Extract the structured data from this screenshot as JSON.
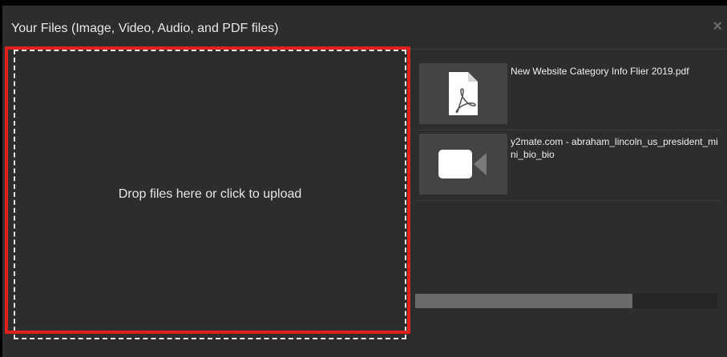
{
  "modal": {
    "title": "Your Files (Image, Video, Audio, and PDF files)",
    "close_label": "×"
  },
  "dropzone": {
    "label": "Drop files here or click to upload",
    "highlight_color": "#e0201f"
  },
  "files": [
    {
      "name": "New Website Category Info Flier 2019.pdf",
      "icon": "pdf-file-icon"
    },
    {
      "name": "y2mate.com - abraham_lincoln_us_president_mini_bio_bio",
      "icon": "video-camera-icon"
    }
  ],
  "upload_progress": {
    "fraction": 0.72
  }
}
